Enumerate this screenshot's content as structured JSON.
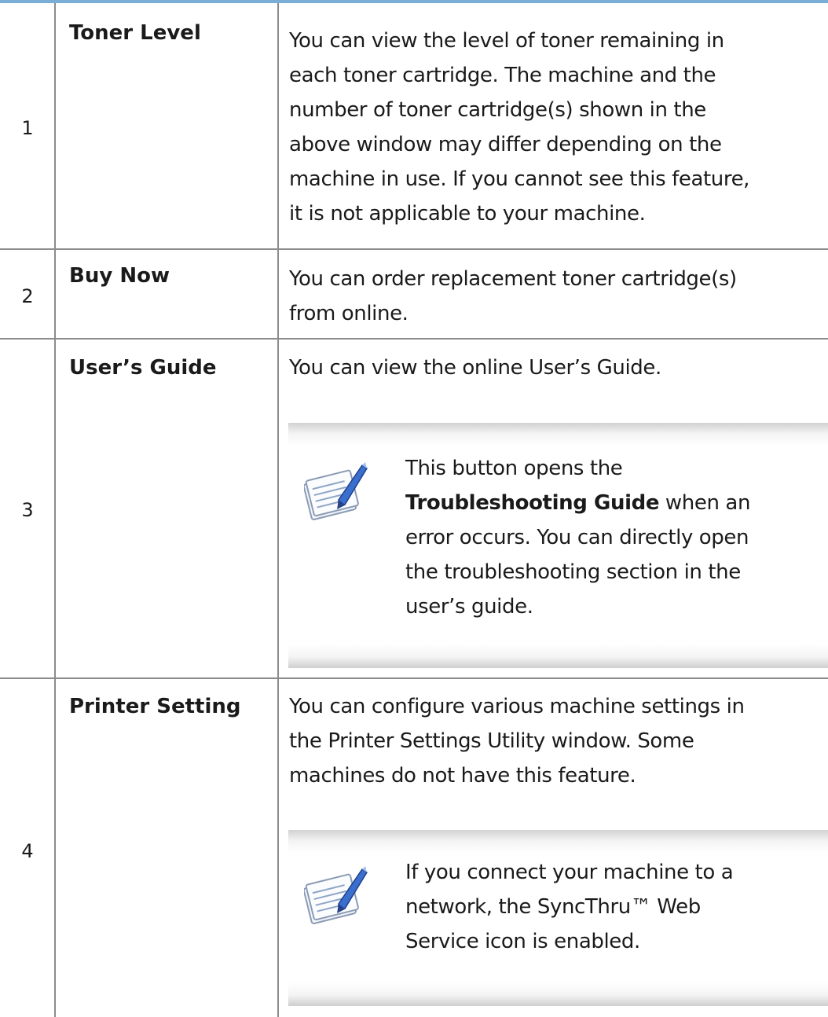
{
  "colors": {
    "top_border": "#7aaed9",
    "grid_line": "#8c8c8c",
    "note_shade": "#cfcfcf",
    "note_icon_accent": "#3a6fd0"
  },
  "rows": [
    {
      "number": "1",
      "feature": "Toner Level",
      "description_lines": [
        "You can view the level of toner remaining in",
        "each toner cartridge. The machine and the",
        "number of toner cartridge(s) shown in the",
        "above window may differ depending on the",
        "machine in use. If you cannot see this feature,",
        "it is not applicable to your machine."
      ]
    },
    {
      "number": "2",
      "feature": "Buy Now",
      "description_lines": [
        "You can order replacement toner cartridge(s)",
        "from online."
      ]
    },
    {
      "number": "3",
      "feature": "User’s Guide",
      "description_lines": [
        "You can view the online User’s Guide."
      ],
      "note": {
        "icon": "note-pen-icon",
        "line1": "This button opens the",
        "line2_bold": "Troubleshooting Guide",
        "line2_rest": " when an",
        "line3": "error occurs. You can directly open",
        "line4": "the troubleshooting section in the",
        "line5": "user’s guide."
      }
    },
    {
      "number": "4",
      "feature": "Printer Setting",
      "description_lines": [
        "You can configure various machine settings in",
        "the Printer Settings Utility window. Some",
        "machines do not have this feature."
      ],
      "note": {
        "icon": "note-pen-icon",
        "line1": "If you connect your machine to a",
        "line2": "network, the SyncThru™ Web",
        "line3": "Service icon is enabled."
      }
    }
  ]
}
